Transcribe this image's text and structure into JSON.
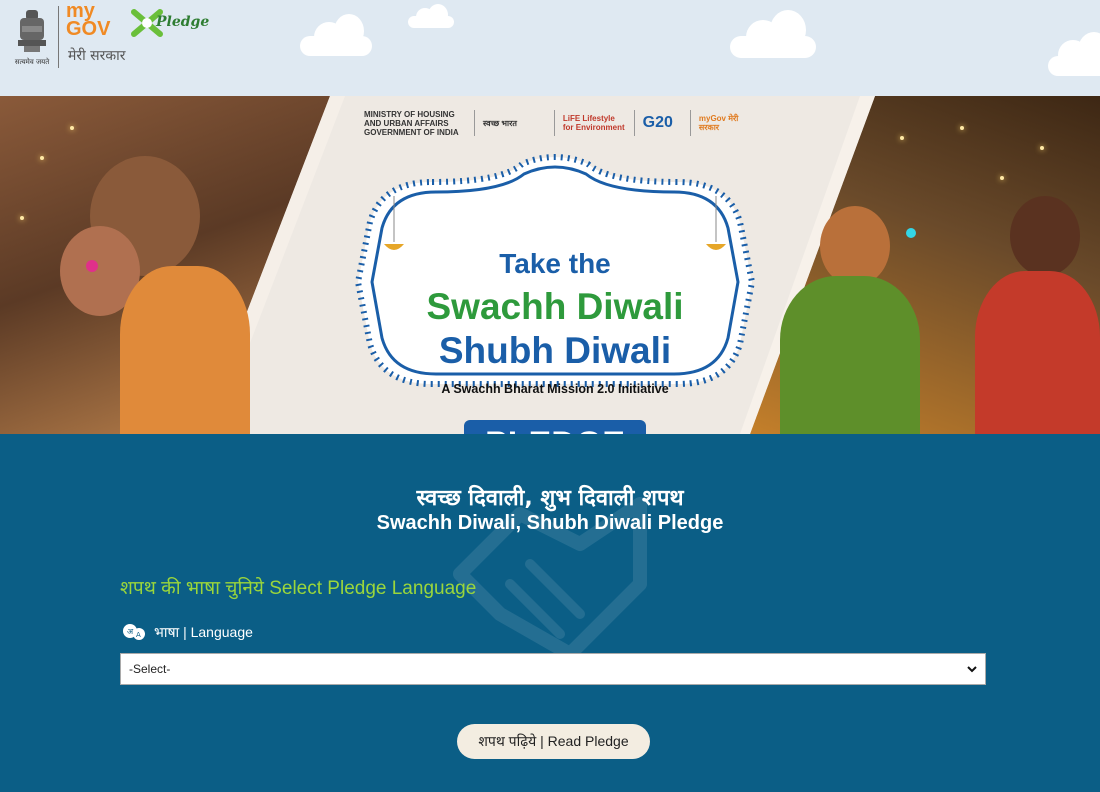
{
  "header": {
    "emblem_caption": "सत्यमेव जयते",
    "logo_my": "my",
    "logo_gov": "GOV",
    "logo_tagline": "मेरी सरकार",
    "pledge_word": "Pledge"
  },
  "banner": {
    "sponsors": [
      "MINISTRY OF HOUSING AND URBAN AFFAIRS GOVERNMENT OF INDIA",
      "स्वच्छ भारत",
      "LiFE Lifestyle for Environment",
      "G20",
      "myGov मेरी सरकार"
    ],
    "line1": "Take the",
    "line2": "Swachh Diwali",
    "line3": "Shubh Diwali",
    "subtitle": "A Swachh Bharat Mission 2.0 Initiative",
    "pledge_badge": "PLEDGE"
  },
  "main": {
    "title_hindi": "स्वच्छ दिवाली, शुभ दिवाली शपथ",
    "title_english": "Swachh Diwali, Shubh Diwali Pledge",
    "select_language_heading": "शपथ की भाषा चुनिये Select Pledge Language",
    "language_label": "भाषा | Language",
    "language_select_value": "-Select-",
    "read_pledge_button": "शपथ पढ़िये | Read Pledge"
  },
  "colors": {
    "header_bg": "#dfe9f2",
    "main_bg": "#0b5e86",
    "accent_green": "#9bd63b",
    "badge_blue": "#1a5ea8",
    "badge_green": "#2e9a3c",
    "button_bg": "#f3ede1"
  }
}
